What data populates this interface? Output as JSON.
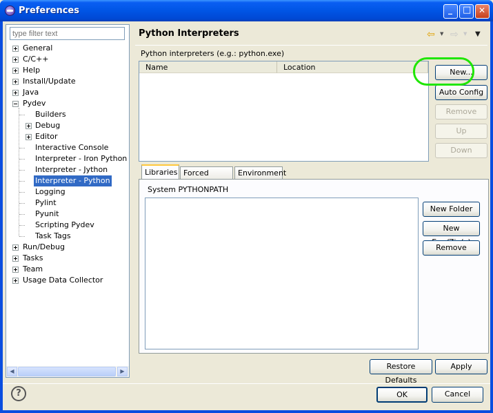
{
  "window": {
    "title": "Preferences",
    "minimize_glyph": "_",
    "maximize_glyph": "□",
    "close_glyph": "✕"
  },
  "filter": {
    "placeholder": "type filter text"
  },
  "tree": [
    {
      "label": "General",
      "level": 0,
      "expander": "plus"
    },
    {
      "label": "C/C++",
      "level": 0,
      "expander": "plus"
    },
    {
      "label": "Help",
      "level": 0,
      "expander": "plus"
    },
    {
      "label": "Install/Update",
      "level": 0,
      "expander": "plus"
    },
    {
      "label": "Java",
      "level": 0,
      "expander": "plus"
    },
    {
      "label": "Pydev",
      "level": 0,
      "expander": "minus"
    },
    {
      "label": "Builders",
      "level": 1,
      "expander": "none"
    },
    {
      "label": "Debug",
      "level": 1,
      "expander": "plus"
    },
    {
      "label": "Editor",
      "level": 1,
      "expander": "plus"
    },
    {
      "label": "Interactive Console",
      "level": 1,
      "expander": "none"
    },
    {
      "label": "Interpreter - Iron Python",
      "level": 1,
      "expander": "none"
    },
    {
      "label": "Interpreter - Jython",
      "level": 1,
      "expander": "none"
    },
    {
      "label": "Interpreter - Python",
      "level": 1,
      "expander": "none",
      "selected": true
    },
    {
      "label": "Logging",
      "level": 1,
      "expander": "none"
    },
    {
      "label": "Pylint",
      "level": 1,
      "expander": "none"
    },
    {
      "label": "Pyunit",
      "level": 1,
      "expander": "none"
    },
    {
      "label": "Scripting Pydev",
      "level": 1,
      "expander": "none"
    },
    {
      "label": "Task Tags",
      "level": 1,
      "expander": "none"
    },
    {
      "label": "Run/Debug",
      "level": 0,
      "expander": "plus"
    },
    {
      "label": "Tasks",
      "level": 0,
      "expander": "plus"
    },
    {
      "label": "Team",
      "level": 0,
      "expander": "plus"
    },
    {
      "label": "Usage Data Collector",
      "level": 0,
      "expander": "plus"
    }
  ],
  "page": {
    "title": "Python Interpreters",
    "nav_back": "⇦",
    "nav_forward": "⇨",
    "nav_dropdown": "▼",
    "menu_dropdown": "▼",
    "interpreters_label": "Python interpreters (e.g.: python.exe)",
    "columns": [
      "Name",
      "Location"
    ],
    "side_buttons": [
      {
        "label": "New...",
        "enabled": true
      },
      {
        "label": "Auto Config",
        "enabled": true
      },
      {
        "label": "Remove",
        "enabled": false
      },
      {
        "label": "Up",
        "enabled": false
      },
      {
        "label": "Down",
        "enabled": false
      }
    ],
    "tabs": [
      {
        "label": "Libraries",
        "active": true
      },
      {
        "label": "Forced Builtins",
        "active": false
      },
      {
        "label": "Environment",
        "active": false
      }
    ],
    "pythonpath_label": "System PYTHONPATH",
    "path_buttons": [
      "New Folder",
      "New Egg/Zip(s)",
      "Remove"
    ],
    "restore_defaults": "Restore Defaults",
    "apply": "Apply"
  },
  "footer": {
    "help_glyph": "?",
    "ok": "OK",
    "cancel": "Cancel"
  }
}
